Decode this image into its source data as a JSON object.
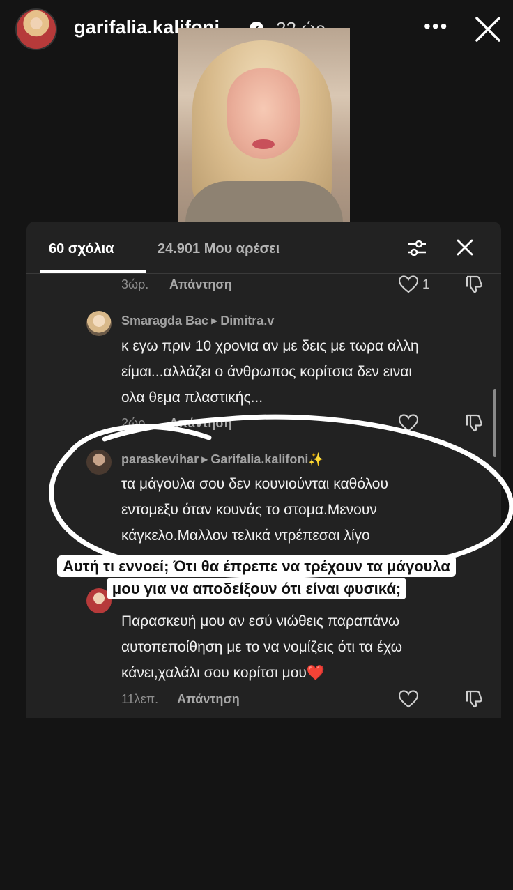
{
  "story": {
    "username": "garifalia.kalifoni",
    "verified_mark": "✔",
    "time": "22 ώρ.",
    "more_icon": "more-dots-icon",
    "close_icon": "close-icon"
  },
  "panel": {
    "tab_comments": "60 σχόλια",
    "tab_likes": "24.901 Μου αρέσει"
  },
  "comments": [
    {
      "meta": "3ώρ.",
      "reply": "Απάντηση",
      "likes": "1"
    },
    {
      "author": "Smaragda Bac",
      "reply_to": "Dimitra.v",
      "lines": [
        "κ εγω πριν 10 χρονια αν με δεις με τωρα αλλη",
        "είμαι...αλλάζει ο άνθρωπος κορίτσια δεν ειναι",
        "ολα θεμα πλαστικής..."
      ],
      "meta": "2ώρ.",
      "reply": "Απάντηση"
    },
    {
      "author": "paraskevihar",
      "reply_to": "Garifalia.kalifoni✨",
      "lines": [
        "τα μάγουλα σου δεν κουνιούνται καθόλου",
        "εντομεξυ όταν κουνάς το στομα.Μενουν",
        "κάγκελο.Μαλλον τελικά ντρέπεσαι λίγο"
      ]
    },
    {
      "lines": [
        "Παρασκευή μου αν εσύ νιώθεις παραπάνω",
        "αυτοπεποίθηση με το να νομίζεις ότι τα έχω",
        "κάνει,χαλάλι σου κορίτσι μου❤️"
      ],
      "meta": "11λεπ.",
      "reply": "Απάντηση"
    }
  ],
  "caption": {
    "line1": "Αυτή τι εννοεί; Ότι θα έπρεπε να τρέχουν τα μάγουλα",
    "line2": "μου για να αποδείξουν ότι είναι φυσικά;"
  },
  "colors": {
    "background": "#141414",
    "panel": "#222222",
    "accent_heart": "#e0245e"
  }
}
